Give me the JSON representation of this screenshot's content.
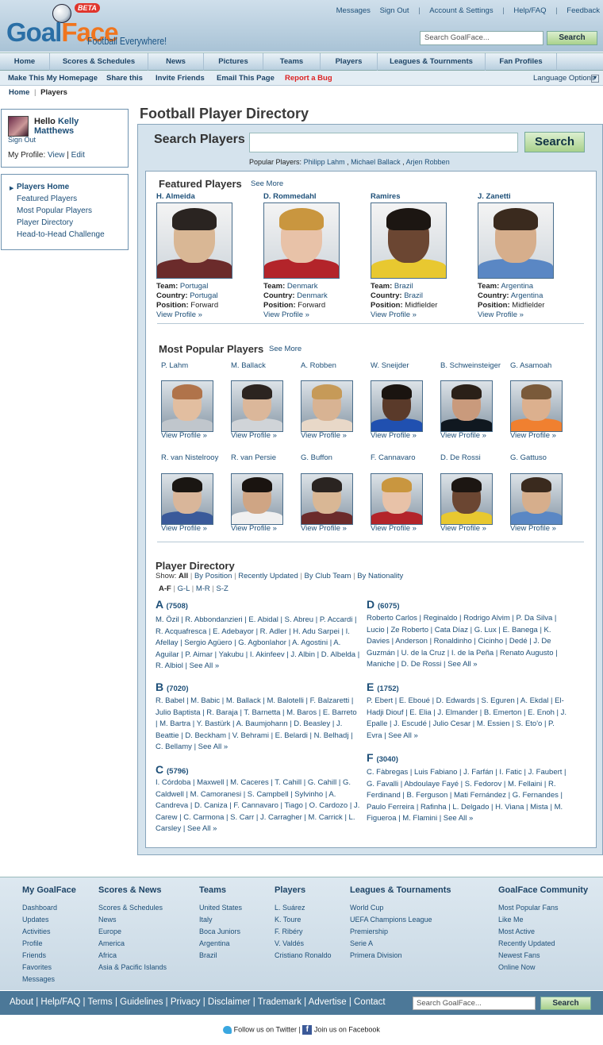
{
  "header": {
    "logo_goal": "Goal",
    "logo_face": "Face",
    "beta": "BETA",
    "tagline": "Football Everywhere!",
    "top_links": [
      "Messages",
      "Sign Out",
      "Account & Settings",
      "Help/FAQ",
      "Feedback"
    ],
    "search_placeholder": "Search GoalFace...",
    "search_button": "Search"
  },
  "nav": [
    "Home",
    "Scores & Schedules",
    "News",
    "Pictures",
    "Teams",
    "Players",
    "Leagues & Tournments",
    "Fan Profiles"
  ],
  "subnav": {
    "items": [
      "Make This My Homepage",
      "Share this",
      "Invite Friends",
      "Email This Page",
      "Report a Bug"
    ],
    "language": "Language Options"
  },
  "breadcrumb": {
    "home": "Home",
    "sep": "|",
    "current": "Players"
  },
  "user": {
    "hello": "Hello",
    "first": "Kelly",
    "last": "Matthews",
    "signout": "Sign Out",
    "profile_label": "My Profile:",
    "view": "View",
    "edit": "Edit"
  },
  "sidebar": {
    "items": [
      "Players Home",
      "Featured Players",
      "Most Popular Players",
      "Player Directory",
      "Head-to-Head Challenge"
    ]
  },
  "page_title": "Football Player Directory",
  "search_players": {
    "label": "Search Players",
    "button": "Search",
    "popular_label": "Popular Players:",
    "popular": [
      "Philipp Lahm",
      "Michael Ballack",
      "Arjen Robben"
    ]
  },
  "featured": {
    "title": "Featured Players",
    "see_more": "See More",
    "labels": {
      "team": "Team:",
      "country": "Country:",
      "position": "Position:",
      "view": "View Profile »"
    },
    "players": [
      {
        "name": "H. Almeida",
        "team": "Portugal",
        "country": "Portugal",
        "position": "Forward"
      },
      {
        "name": "D. Rommedahl",
        "team": "Denmark",
        "country": "Denmark",
        "position": "Forward"
      },
      {
        "name": "Ramires",
        "team": "Brazil",
        "country": "Brazil",
        "position": "Midfielder"
      },
      {
        "name": "J. Zanetti",
        "team": "Argentina",
        "country": "Argentina",
        "position": "Midfielder"
      }
    ]
  },
  "popular": {
    "title": "Most Popular Players",
    "see_more": "See More",
    "view": "View Profile »",
    "players": [
      {
        "name": "P. Lahm"
      },
      {
        "name": "M. Ballack"
      },
      {
        "name": "A. Robben"
      },
      {
        "name": "W. Sneijder"
      },
      {
        "name": "B. Schweinsteiger"
      },
      {
        "name": "G. Asamoah"
      },
      {
        "name": "R. van Nistelrooy"
      },
      {
        "name": "R. van Persie"
      },
      {
        "name": "G. Buffon"
      },
      {
        "name": "F. Cannavaro"
      },
      {
        "name": "D. De Rossi"
      },
      {
        "name": "G. Gattuso"
      }
    ]
  },
  "directory": {
    "title": "Player Directory",
    "show_label": "Show:",
    "filters": [
      "All",
      "By Position",
      "Recently Updated",
      "By Club Team",
      "By Nationality"
    ],
    "ranges": [
      "A-F",
      "G-L",
      "M-R",
      "S-Z"
    ],
    "letters": [
      {
        "letter": "A",
        "count": "(7508)",
        "names": "M. Özil | R. Abbondanzieri | E. Abidal | S. Abreu | P. Accardi | R. Acquafresca | E. Adebayor | R. Adler | H. Adu Sarpei | I. Afellay | Sergio Agüero | G. Agbonlahor | A. Agostini | A. Aguilar | P. Aimar | Yakubu | I. Akinfeev | J. Albin | D. Albelda | R. Albiol | See All »"
      },
      {
        "letter": "B",
        "count": "(7020)",
        "names": "R. Babel | M. Babic | M. Ballack | M. Balotelli | F. Balzaretti | Julio Baptista | R. Baraja | T. Barnetta | M. Baros | E. Barreto | M. Bartra | Y. Bastürk | A. Baumjohann | D. Beasley | J. Beattie | D. Beckham | V. Behrami | E. Belardi | N. Belhadj | C. Bellamy | See All »"
      },
      {
        "letter": "C",
        "count": "(5796)",
        "names": "I. Córdoba | Maxwell | M. Caceres | T. Cahill | G. Cahill | G. Caldwell | M. Camoranesi | S. Campbell | Sylvinho | A. Candreva | D. Caniza | F. Cannavaro | Tiago | O. Cardozo | J. Carew | C. Carmona | S. Carr | J. Carragher | M. Carrick | L. Carsley | See All »"
      },
      {
        "letter": "D",
        "count": "(6075)",
        "names": "Roberto Carlos | Reginaldo | Rodrigo Alvim | P. Da Silva | Lucio | Ze Roberto | Cata Díaz | G. Lux | E. Banega | K. Davies | Anderson | Ronaldinho | Cicinho | Dedé | J. De Guzmán | U. de la Cruz | I. de la Peña | Renato Augusto | Maniche | D. De Rossi | See All »"
      },
      {
        "letter": "E",
        "count": "(1752)",
        "names": "P. Ebert | E. Eboué | D. Edwards | S. Eguren | A. Ekdal | El-Hadji Diouf | E. Elia | J. Elmander | B. Emerton | E. Enoh | J. Epalle | J. Escudé | Julio Cesar | M. Essien | S. Eto'o | P. Evra | See All »"
      },
      {
        "letter": "F",
        "count": "(3040)",
        "names": "C. Fàbregas | Luis Fabiano | J. Farfán | I. Fatic | J. Faubert | G. Favalli | Abdoulaye Fayé | S. Fedorov | M. Fellaini | R. Ferdinand | B. Ferguson | Mati Fernández | G. Fernandes | Paulo Ferreira | Rafinha | L. Delgado | H. Viana | Mista | M. Figueroa | M. Flamini | See All »"
      }
    ]
  },
  "footer": {
    "columns": [
      {
        "title": "My GoalFace",
        "items": [
          "Dashboard",
          "Updates",
          "Activities",
          "Profile",
          "Friends",
          "Favorites",
          "Messages"
        ]
      },
      {
        "title": "Scores & News",
        "items": [
          "Scores & Schedules",
          "News",
          "Europe",
          "America",
          "Africa",
          "Asia & Pacific Islands"
        ]
      },
      {
        "title": "Teams",
        "items": [
          "United States",
          "Italy",
          "Boca Juniors",
          "Argentina",
          "Brazil"
        ]
      },
      {
        "title": "Players",
        "items": [
          "L. Suárez",
          "K. Toure",
          "F. Ribéry",
          "V. Valdés",
          "Cristiano Ronaldo"
        ]
      },
      {
        "title": "Leagues & Tournaments",
        "items": [
          "World Cup",
          "UEFA Champions League",
          "Premiership",
          "Serie A",
          "Primera Division"
        ]
      },
      {
        "title": "GoalFace Community",
        "items": [
          "Most Popular Fans",
          "Like Me",
          "Most Active",
          "Recently Updated",
          "Newest Fans",
          "Online Now"
        ]
      }
    ],
    "bar_links": "About | Help/FAQ | Terms | Guidelines | Privacy | Disclaimer | Trademark | Advertise | Contact",
    "search_placeholder": "Search GoalFace...",
    "search_button": "Search",
    "twitter": "Follow us on Twitter",
    "sep": "|",
    "facebook": "Join us on Facebook"
  },
  "colors": {
    "link": "#1d4f78",
    "accent_orange": "#f0751e",
    "header_blue": "#2a6fa6",
    "report_red": "#dd2222",
    "footer_bar": "#4c7898"
  }
}
